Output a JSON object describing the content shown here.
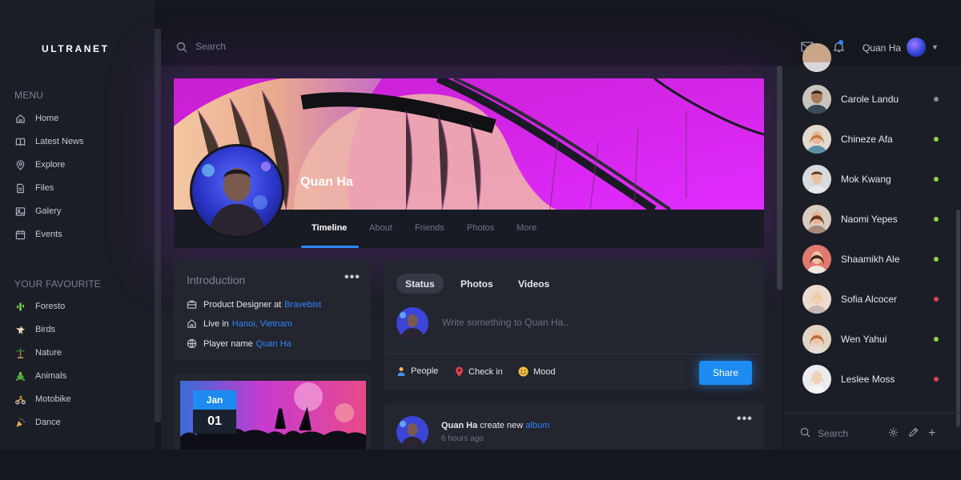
{
  "app": {
    "brand": "ULTRANET"
  },
  "colors": {
    "accent": "#2f86ff",
    "button": "#1d8bf1",
    "online": "#8ed64a",
    "busy": "#e2414d",
    "away": "#8a8d99"
  },
  "sidebar": {
    "menu_title": "MENU",
    "menu": [
      {
        "label": "Home",
        "icon": "home-icon"
      },
      {
        "label": "Latest News",
        "icon": "book-icon"
      },
      {
        "label": "Explore",
        "icon": "location-pin-icon"
      },
      {
        "label": "Files",
        "icon": "file-icon"
      },
      {
        "label": "Galery",
        "icon": "image-icon"
      },
      {
        "label": "Events",
        "icon": "calendar-icon"
      }
    ],
    "fav_title": "YOUR FAVOURITE",
    "favourites": [
      {
        "label": "Foresto",
        "icon": "cactus-icon"
      },
      {
        "label": "Birds",
        "icon": "eagle-icon"
      },
      {
        "label": "Nature",
        "icon": "palm-tree-icon"
      },
      {
        "label": "Animals",
        "icon": "turtle-icon"
      },
      {
        "label": "Motobike",
        "icon": "motorbike-icon"
      },
      {
        "label": "Dance",
        "icon": "party-popper-icon"
      }
    ]
  },
  "topbar": {
    "search_placeholder": "Search",
    "user_name": "Quan Ha"
  },
  "profile": {
    "name": "Quan Ha",
    "tabs": [
      "Timeline",
      "About",
      "Friends",
      "Photos",
      "More"
    ],
    "active_tab": "Timeline"
  },
  "intro": {
    "title": "Introduction",
    "job_prefix": "Product Designer at",
    "job_link": "Bravebist",
    "live_prefix": "Live in",
    "live_link": "Hanoi, Vietnam",
    "player_prefix": "Player name",
    "player_link": "Quan Ha"
  },
  "event": {
    "month": "Jan",
    "day": "01"
  },
  "composer": {
    "tabs": [
      "Status",
      "Photos",
      "Videos"
    ],
    "active_tab": "Status",
    "placeholder": "Write something to Quan Ha..",
    "actions": [
      "People",
      "Check in",
      "Mood"
    ],
    "share_label": "Share"
  },
  "post": {
    "author": "Quan Ha",
    "action": "create new",
    "link": "album",
    "time": "6 hours ago"
  },
  "contacts": [
    {
      "name": "Carole Landu",
      "status": "away"
    },
    {
      "name": "Chineze Afa",
      "status": "online"
    },
    {
      "name": "Mok Kwang",
      "status": "online"
    },
    {
      "name": "Naomi Yepes",
      "status": "online"
    },
    {
      "name": "Shaamikh Ale",
      "status": "online"
    },
    {
      "name": "Sofia Alcocer",
      "status": "busy"
    },
    {
      "name": "Wen Yahui",
      "status": "online"
    },
    {
      "name": "Leslee Moss",
      "status": "busy"
    }
  ],
  "contacts_search_placeholder": "Search"
}
